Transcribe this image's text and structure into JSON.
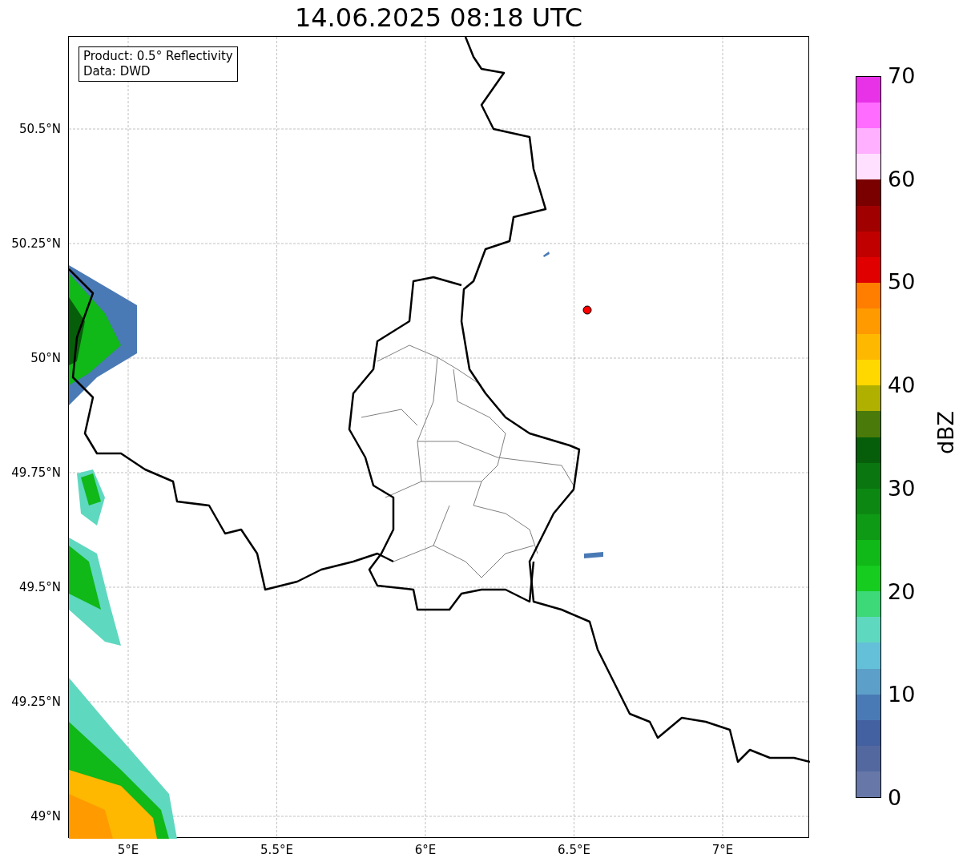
{
  "title": "14.06.2025 08:18 UTC",
  "info_box": {
    "lines": [
      "Product: 0.5° Reflectivity",
      "Data: DWD"
    ]
  },
  "latitude_ticks": [
    "50.5°N",
    "50.25°N",
    "50°N",
    "49.75°N",
    "49.5°N",
    "49.25°N",
    "49°N"
  ],
  "longitude_ticks": [
    "5°E",
    "5.5°E",
    "6°E",
    "6.5°E",
    "7°E"
  ],
  "colorbar": {
    "label": "dBZ",
    "ticks": [
      "70",
      "60",
      "50",
      "40",
      "30",
      "20",
      "10",
      "0"
    ],
    "bins": [
      {
        "color": "#e832e8"
      },
      {
        "color": "#ff6cff"
      },
      {
        "color": "#ffb0ff"
      },
      {
        "color": "#ffe0ff"
      },
      {
        "color": "#7a0000"
      },
      {
        "color": "#a00000"
      },
      {
        "color": "#c00000"
      },
      {
        "color": "#e00000"
      },
      {
        "color": "#ff7e00"
      },
      {
        "color": "#ff9a00"
      },
      {
        "color": "#ffb800"
      },
      {
        "color": "#ffd800"
      },
      {
        "color": "#b0b000"
      },
      {
        "color": "#4a7a0a"
      },
      {
        "color": "#075e0a"
      },
      {
        "color": "#0a7610"
      },
      {
        "color": "#0c8812"
      },
      {
        "color": "#0e9a14"
      },
      {
        "color": "#10b818"
      },
      {
        "color": "#16cc1e"
      },
      {
        "color": "#3dd878"
      },
      {
        "color": "#5fd8c0"
      },
      {
        "color": "#64c0d8"
      },
      {
        "color": "#5c9fc8"
      },
      {
        "color": "#4a7ab5"
      },
      {
        "color": "#4360a0"
      },
      {
        "color": "#5468a0"
      },
      {
        "color": "#6778a8"
      }
    ]
  }
}
